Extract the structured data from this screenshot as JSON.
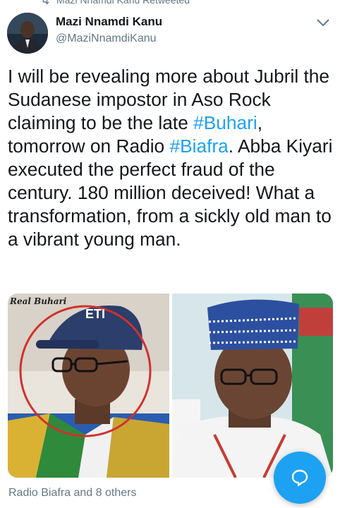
{
  "retweet": {
    "label": "Mazi Nnamdi Kanu Retweeted"
  },
  "author": {
    "name": "Mazi Nnamdi Kanu",
    "handle": "@MaziNnamdiKanu"
  },
  "tweet": {
    "part1": "I will be revealing more about Jubril the Sudanese impostor in Aso Rock claiming to be the late ",
    "hashtag1": "#Buhari",
    "part2": ", tomorrow on Radio ",
    "hashtag2": "#Biafra",
    "part3": ". Abba Kiyari executed the perfect fraud of the century. 180 million deceived! What a transformation, from a sickly old man to a vibrant young man."
  },
  "media": {
    "left_caption": "Real Buhari",
    "cap_text": "ETI"
  },
  "footer": {
    "likes_text": "Radio Biafra and 8 others"
  },
  "icons": {
    "retweet": "retweet-icon",
    "chevron": "chevron-down-icon",
    "compose": "compose-reply-icon"
  },
  "colors": {
    "accent": "#1da1f2",
    "secondary_text": "#657786"
  }
}
